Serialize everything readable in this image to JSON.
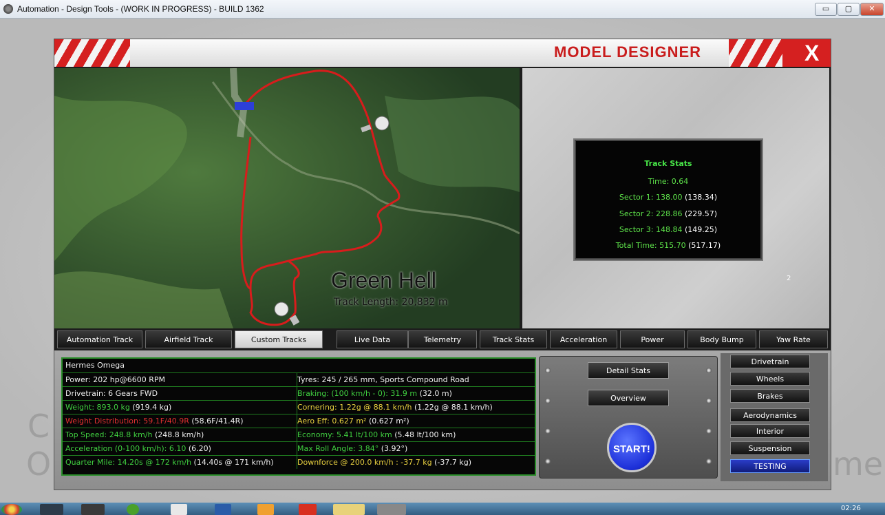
{
  "window": {
    "title": "Automation - Design Tools - (WORK IN PROGRESS) - BUILD 1362",
    "minimize": "▭",
    "maximize": "▢",
    "close": "✕"
  },
  "header": {
    "title": "MODEL DESIGNER",
    "close": "X"
  },
  "map": {
    "track_name": "Green Hell",
    "track_length": "Track Length: 20,832 m"
  },
  "track_stats": {
    "title": "Track Stats",
    "time": "Time: 0.64",
    "sector1": "Sector 1: 138.00",
    "sector1_prev": "(138.34)",
    "sector2": "Sector 2: 228.86",
    "sector2_prev": "(229.57)",
    "sector3": "Sector 3: 148.84",
    "sector3_prev": "(149.25)",
    "total": "Total Time: 515.70",
    "total_prev": "(517.17)"
  },
  "page_number": "2",
  "track_tabs": [
    "Automation Track",
    "Airfield Track",
    "Custom Tracks"
  ],
  "view_tabs": [
    "Live Data",
    "Telemetry",
    "Track Stats",
    "Acceleration",
    "Power",
    "Body Bump",
    "Yaw Rate"
  ],
  "car": {
    "name": "Hermes Omega",
    "power": "Power: 202 hp@6600 RPM",
    "tyres": "Tyres: 245 / 265 mm, Sports Compound Road",
    "drivetrain": "Drivetrain: 6 Gears FWD",
    "braking": "Braking: (100 km/h - 0): 31.9 m",
    "braking_prev": "(32.0 m)",
    "weight": "Weight: 893.0 kg",
    "weight_prev": "(919.4 kg)",
    "cornering": "Cornering: 1.22g @ 88.1 km/h",
    "cornering_prev": "(1.22g @ 88.1 km/h)",
    "weight_dist": "Weight Distribution: 59.1F/40.9R",
    "weight_dist_prev": "(58.6F/41.4R)",
    "aero": "Aero Eff: 0.627 m²",
    "aero_prev": "(0.627 m²)",
    "top_speed": "Top Speed: 248.8 km/h",
    "top_speed_prev": "(248.8 km/h)",
    "economy": "Economy: 5.41 lt/100 km",
    "economy_prev": "(5.48 lt/100 km)",
    "acceleration": "Acceleration (0-100 km/h): 6.10",
    "acceleration_prev": "(6.20)",
    "roll": "Max Roll Angle: 3.84°",
    "roll_prev": "(3.92°)",
    "quarter": "Quarter Mile: 14.20s @ 172 km/h",
    "quarter_prev": "(14.40s @ 171 km/h)",
    "downforce": "Downforce @ 200.0 km/h : -37.7 kg",
    "downforce_prev": "(-37.7 kg)"
  },
  "controls": {
    "detail_stats": "Detail Stats",
    "overview": "Overview",
    "start": "START!"
  },
  "sidebar": [
    "Drivetrain",
    "Wheels",
    "Brakes",
    "Aerodynamics",
    "Interior",
    "Suspension",
    "TESTING"
  ],
  "taskbar": {
    "clock": "02:26"
  },
  "colors": {
    "accent_red": "#d52020",
    "stat_green": "#40d040",
    "stat_yellow": "#e8d040",
    "start_blue": "#1c2fd8"
  }
}
